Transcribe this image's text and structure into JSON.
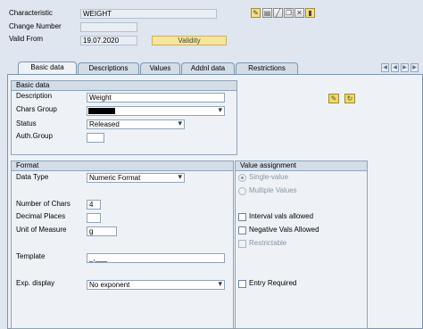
{
  "header": {
    "characteristic_label": "Characteristic",
    "characteristic_value": "WEIGHT",
    "change_number_label": "Change Number",
    "change_number_value": "",
    "valid_from_label": "Valid From",
    "valid_from_value": "19.07.2020",
    "validity_button": "Validity"
  },
  "toolbar_icons": [
    "change-icon",
    "document-icon",
    "edit-icon",
    "copy-icon",
    "delete-icon"
  ],
  "tabs": [
    {
      "label": "Basic data",
      "active": true
    },
    {
      "label": "Descriptions",
      "active": false
    },
    {
      "label": "Values",
      "active": false
    },
    {
      "label": "Addnl data",
      "active": false
    },
    {
      "label": "Restrictions",
      "active": false
    }
  ],
  "basic_data": {
    "title": "Basic data",
    "description_label": "Description",
    "description_value": "Weight",
    "chars_group_label": "Chars Group",
    "chars_group_value": "",
    "status_label": "Status",
    "status_value": "Released",
    "auth_group_label": "Auth.Group",
    "auth_group_value": ""
  },
  "format": {
    "title": "Format",
    "data_type_label": "Data Type",
    "data_type_value": "Numeric Format",
    "num_chars_label": "Number of Chars",
    "num_chars_value": "4",
    "decimal_places_label": "Decimal Places",
    "decimal_places_value": "",
    "uom_label": "Unit of Measure",
    "uom_value": "g",
    "template_label": "Template",
    "template_value": "_,___",
    "exp_display_label": "Exp. display",
    "exp_display_value": "No exponent"
  },
  "value_assignment": {
    "title": "Value assignment",
    "single_value": "Single-value",
    "multiple_values": "Multiple Values",
    "single_value_selected": true,
    "interval_vals": "Interval vals allowed",
    "interval_vals_checked": false,
    "negative_vals": "Negative Vals Allowed",
    "negative_vals_checked": false,
    "restrictable": "Restrictable",
    "restrictable_checked": false,
    "entry_required": "Entry Required",
    "entry_required_checked": false
  }
}
